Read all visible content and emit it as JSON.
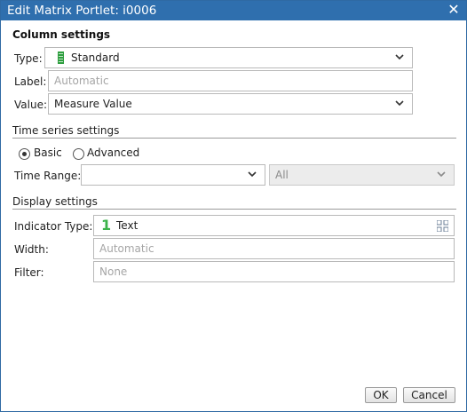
{
  "window": {
    "title": "Edit Matrix Portlet: i0006"
  },
  "column_settings": {
    "heading": "Column settings",
    "type_label": "Type:",
    "type_value": "Standard",
    "label_label": "Label:",
    "label_placeholder": "Automatic",
    "value_label": "Value:",
    "value_value": "Measure Value"
  },
  "time_series": {
    "heading": "Time series settings",
    "radio_basic": "Basic",
    "radio_advanced": "Advanced",
    "selected": "Basic",
    "time_range_label": "Time Range:",
    "time_range_value": "",
    "secondary_value": "All"
  },
  "display_settings": {
    "heading": "Display settings",
    "indicator_label": "Indicator Type:",
    "indicator_glyph": "1",
    "indicator_value": "Text",
    "width_label": "Width:",
    "width_placeholder": "Automatic",
    "filter_label": "Filter:",
    "filter_placeholder": "None"
  },
  "buttons": {
    "ok": "OK",
    "cancel": "Cancel"
  },
  "icons": {
    "close": "close-icon",
    "type": "column-bar-icon",
    "dropdown": "chevron-down-icon",
    "indicator_picker": "grid-icon"
  },
  "colors": {
    "titlebar": "#2f6fae",
    "indicator_green": "#3bb24a",
    "type_icon_green": "#2e9e3f"
  }
}
